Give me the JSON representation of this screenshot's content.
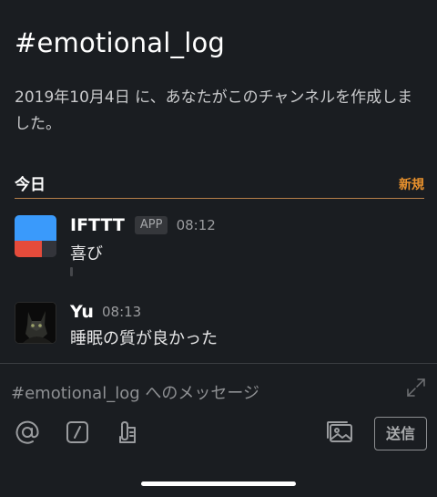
{
  "channel": {
    "title": "#emotional_log",
    "intro": "2019年10月4日 に、あなたがこのチャンネルを作成しました。"
  },
  "divider": {
    "label": "今日",
    "new_label": "新規"
  },
  "messages": [
    {
      "author": "IFTTT",
      "badge": "APP",
      "time": "08:12",
      "text": "喜び"
    },
    {
      "author": "Yu",
      "time": "08:13",
      "text": "睡眠の質が良かった"
    }
  ],
  "composer": {
    "placeholder": "#emotional_log へのメッセージ",
    "send_label": "送信"
  },
  "icons": [
    "expand-icon",
    "at-icon",
    "slash-command-icon",
    "attachment-icon",
    "image-icon"
  ],
  "colors": {
    "background": "#1a1d21",
    "new_accent": "#e8912d",
    "divider_line": "#b7804a"
  }
}
